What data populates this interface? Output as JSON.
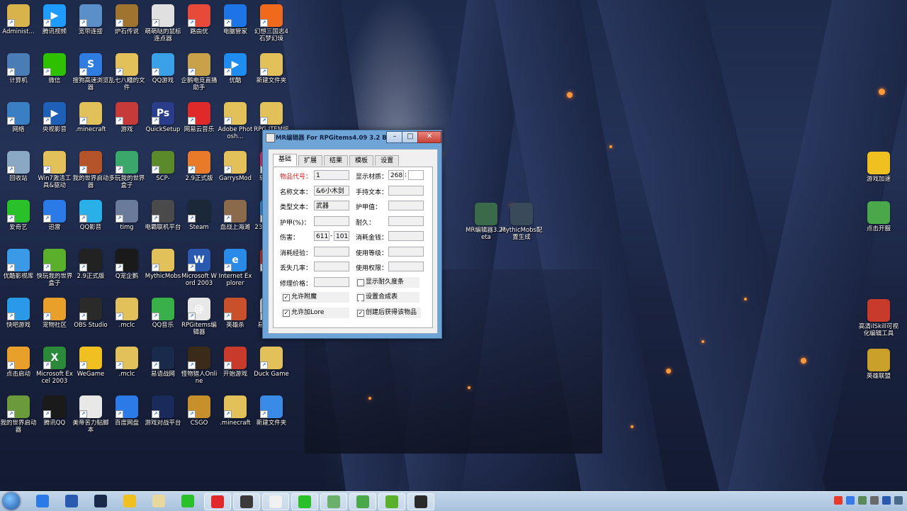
{
  "desktop_icons": [
    {
      "label": "Administ...",
      "color": "#d8b24a",
      "glyph": ""
    },
    {
      "label": "腾讯视频",
      "color": "#1e9bff",
      "glyph": "▶"
    },
    {
      "label": "宽带连接",
      "color": "#5b8fc9",
      "glyph": ""
    },
    {
      "label": "炉石传说",
      "color": "#a0742e",
      "glyph": ""
    },
    {
      "label": "萌萌哒的鼠标连点器",
      "color": "#e0e0e0",
      "glyph": ""
    },
    {
      "label": "路由优",
      "color": "#e84a3a",
      "glyph": ""
    },
    {
      "label": "电脑管家",
      "color": "#1d74e6",
      "glyph": ""
    },
    {
      "label": "幻想三国志4石梦幻境",
      "color": "#f06a1c",
      "glyph": ""
    },
    {
      "label": "计算机",
      "color": "#4a7db5",
      "glyph": ""
    },
    {
      "label": "微信",
      "color": "#2dc100",
      "glyph": ""
    },
    {
      "label": "搜狗高速浏览器",
      "color": "#2f7de1",
      "glyph": "S"
    },
    {
      "label": "乱七八糟的文件",
      "color": "#e2c15a",
      "glyph": ""
    },
    {
      "label": "QQ游戏",
      "color": "#3aa0e8",
      "glyph": ""
    },
    {
      "label": "企鹅电竞直播助手",
      "color": "#c8a14a",
      "glyph": ""
    },
    {
      "label": "优酷",
      "color": "#1e8cf0",
      "glyph": "▶"
    },
    {
      "label": "新建文件夹",
      "color": "#e2c15a",
      "glyph": ""
    },
    {
      "label": "网络",
      "color": "#3a7fc4",
      "glyph": ""
    },
    {
      "label": "央视影音",
      "color": "#1e5fb8",
      "glyph": "▶"
    },
    {
      "label": ".minecraft",
      "color": "#e2c15a",
      "glyph": ""
    },
    {
      "label": "游戏",
      "color": "#c73a3a",
      "glyph": ""
    },
    {
      "label": "QuickSetup",
      "color": "#2a3d8a",
      "glyph": "Ps"
    },
    {
      "label": "网易云音乐",
      "color": "#e02a2a",
      "glyph": ""
    },
    {
      "label": "Adobe Photosh...",
      "color": "#e2c15a",
      "glyph": ""
    },
    {
      "label": "RPG ITEM编辑器",
      "color": "#e2c15a",
      "glyph": ""
    },
    {
      "label": "回收站",
      "color": "#8aa7c4",
      "glyph": ""
    },
    {
      "label": "Win7激活工具&驱动",
      "color": "#e2c15a",
      "glyph": ""
    },
    {
      "label": "我的世界启动器",
      "color": "#b5542a",
      "glyph": ""
    },
    {
      "label": "多玩我的世界盒子",
      "color": "#3aa86a",
      "glyph": ""
    },
    {
      "label": "SCP-",
      "color": "#5a8a2a",
      "glyph": ""
    },
    {
      "label": "2.9正式版",
      "color": "#e87a2a",
      "glyph": ""
    },
    {
      "label": "GarrysMod",
      "color": "#e2c15a",
      "glyph": ""
    },
    {
      "label": "软件管理",
      "color": "#e83a7a",
      "glyph": ""
    },
    {
      "label": "爱奇艺",
      "color": "#2ac02a",
      "glyph": ""
    },
    {
      "label": "迅雷",
      "color": "#2a7ae8",
      "glyph": ""
    },
    {
      "label": "QQ影音",
      "color": "#2ab0e8",
      "glyph": ""
    },
    {
      "label": "timg",
      "color": "#6a7a9a",
      "glyph": ""
    },
    {
      "label": "电霸联机平台",
      "color": "#4a4a4a",
      "glyph": ""
    },
    {
      "label": "Steam",
      "color": "#1b2838",
      "glyph": ""
    },
    {
      "label": "血战上海滩",
      "color": "#8a6a4a",
      "glyph": ""
    },
    {
      "label": "2345看图王",
      "color": "#3a9ae8",
      "glyph": ""
    },
    {
      "label": "优酷影视库",
      "color": "#3a9ae8",
      "glyph": ""
    },
    {
      "label": "快玩我的世界盒子",
      "color": "#5ab02a",
      "glyph": ""
    },
    {
      "label": "2.9正式版",
      "color": "#222222",
      "glyph": ""
    },
    {
      "label": "Q宠企鹅",
      "color": "#1a1a1a",
      "glyph": ""
    },
    {
      "label": "MythicMobs",
      "color": "#e2c15a",
      "glyph": ""
    },
    {
      "label": "Microsoft Word 2003",
      "color": "#2a5ab0",
      "glyph": "W"
    },
    {
      "label": "Internet Explorer",
      "color": "#2a8ae8",
      "glyph": "e"
    },
    {
      "label": "好压",
      "color": "#c83a2a",
      "glyph": ""
    },
    {
      "label": "快吧游戏",
      "color": "#2a9ae8",
      "glyph": ""
    },
    {
      "label": "宠物社区",
      "color": "#e8a02a",
      "glyph": ""
    },
    {
      "label": "OBS Studio",
      "color": "#2a2a2a",
      "glyph": ""
    },
    {
      "label": ".mclc",
      "color": "#e2c15a",
      "glyph": ""
    },
    {
      "label": "QQ音乐",
      "color": "#3ab04a",
      "glyph": ""
    },
    {
      "label": "RPGitems编辑器",
      "color": "#e8e8e8",
      "glyph": "@"
    },
    {
      "label": "英雄杀",
      "color": "#c8502a",
      "glyph": ""
    },
    {
      "label": "易语言5.8",
      "color": "#e8e8e8",
      "glyph": ""
    },
    {
      "label": "点击启动",
      "color": "#e8a02a",
      "glyph": ""
    },
    {
      "label": "Microsoft Excel 2003",
      "color": "#2a8a3a",
      "glyph": "X"
    },
    {
      "label": "WeGame",
      "color": "#f0c020",
      "glyph": ""
    },
    {
      "label": ".mclc",
      "color": "#e2c15a",
      "glyph": ""
    },
    {
      "label": "易语战网",
      "color": "#1a2a4a",
      "glyph": ""
    },
    {
      "label": "怪物猎人Online",
      "color": "#3a2a1a",
      "glyph": ""
    },
    {
      "label": "开始游戏",
      "color": "#c83a2a",
      "glyph": ""
    },
    {
      "label": "Duck Game",
      "color": "#e2c15a",
      "glyph": ""
    },
    {
      "label": "我的世界启动器",
      "color": "#6a9a3a",
      "glyph": ""
    },
    {
      "label": "腾讯QQ",
      "color": "#1a1a1a",
      "glyph": ""
    },
    {
      "label": "美帝苦力贴脚本",
      "color": "#e8e8e8",
      "glyph": ""
    },
    {
      "label": "百度网盘",
      "color": "#2a7ae8",
      "glyph": ""
    },
    {
      "label": "游戏对战平台",
      "color": "#1a2a5a",
      "glyph": ""
    },
    {
      "label": "CSGO",
      "color": "#c8902a",
      "glyph": ""
    },
    {
      "label": ".minecraft",
      "color": "#e2c15a",
      "glyph": ""
    },
    {
      "label": "新建文件夹",
      "color": "#3a8ae8",
      "glyph": ""
    }
  ],
  "right_icons": [
    {
      "label": "MR编辑器3.2beta",
      "color": "#3a6a4a"
    },
    {
      "label": "MythicMobs配置生成",
      "color": "#3a4a5a"
    },
    {
      "label": "游戏加速",
      "color": "#f0c020"
    },
    {
      "label": "点击开服",
      "color": "#4aa84a"
    },
    {
      "label": "高清ilSkill可视化编辑工具",
      "color": "#c83a2a"
    },
    {
      "label": "英雄联盟",
      "color": "#c8a02a"
    }
  ],
  "window": {
    "title": "MR编辑器 For RPGitems4.09 3.2 Beta",
    "min": "–",
    "max": "□",
    "close": "✕",
    "tabs": [
      "基础",
      "扩展",
      "结果",
      "模板",
      "设置"
    ],
    "fields": {
      "item_id_label": "物品代号：",
      "item_id": "1",
      "material_label": "显示材质：",
      "material": "268",
      "material_sep": ":",
      "name_label": "名称文本：",
      "name": "&6小木剑",
      "hand_label": "手持文本：",
      "type_label": "类型文本：",
      "type": "武器",
      "armor_val_label": "护甲值：",
      "armor_pct_label": "护甲(%)：",
      "durability_label": "耐久：",
      "damage_label": "伤害：",
      "damage_min": "611",
      "damage_sep": "-",
      "damage_max": "101",
      "money_label": "消耗金钱：",
      "exp_label": "消耗经验：",
      "level_label": "使用等级：",
      "drop_label": "丢失几率：",
      "perm_label": "使用权限：",
      "repair_label": "修理价格："
    },
    "checks": {
      "show_durability": "显示耐久度条",
      "allow_enchant": "允许附魔",
      "set_recipe": "设置合成表",
      "allow_lore": "允许加Lore",
      "create_obtain": "创建后获得该物品"
    }
  }
}
